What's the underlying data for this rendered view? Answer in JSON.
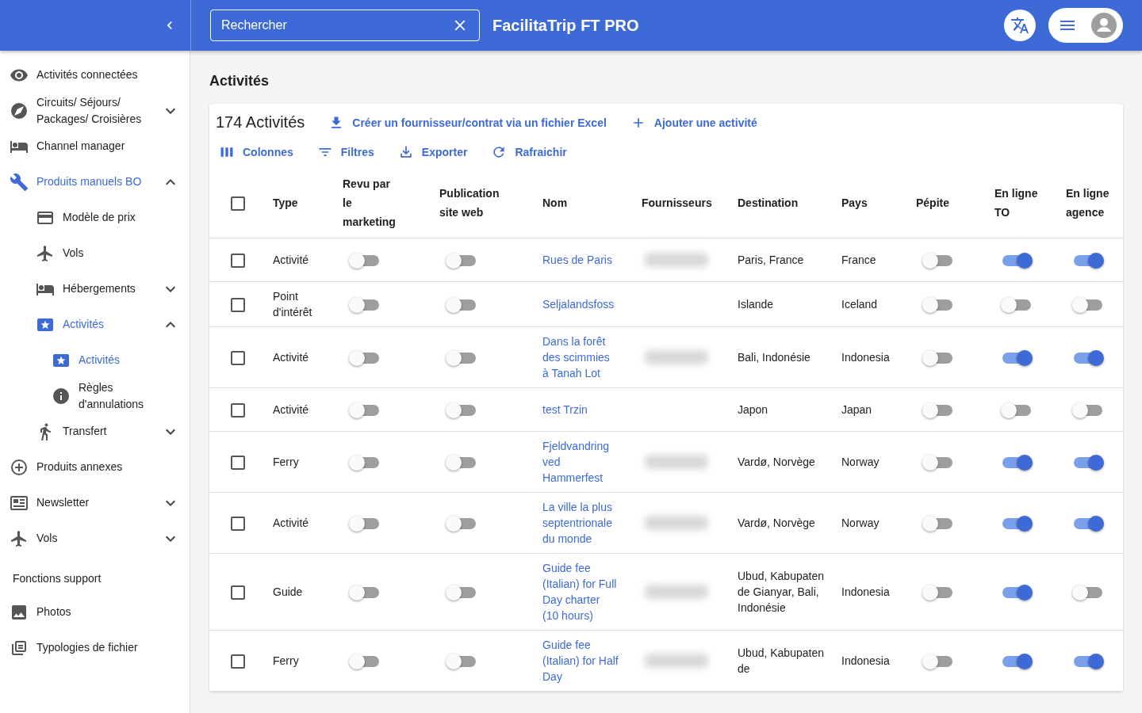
{
  "header": {
    "search": {
      "placeholder": "Rechercher"
    },
    "app_title": "FacilitaTrip FT PRO"
  },
  "sidebar": {
    "items": [
      {
        "kind": "link",
        "label": "Activités connectées",
        "selected": false
      },
      {
        "kind": "link",
        "label": "Circuits/ Séjours/ Packages/ Croisières",
        "selected": false,
        "expanded": false
      },
      {
        "kind": "link",
        "label": "Channel manager",
        "selected": false
      },
      {
        "kind": "link",
        "label": "Produits manuels BO",
        "selected": true,
        "expanded": true,
        "children": [
          {
            "label": "Modèle de prix",
            "selected": false
          },
          {
            "label": "Vols",
            "selected": false
          },
          {
            "label": "Hébergements",
            "selected": false,
            "expanded": false
          },
          {
            "label": "Activités",
            "selected": true,
            "expanded": true,
            "children": [
              {
                "label": "Activités",
                "selected": true
              },
              {
                "label": "Règles d'annulations",
                "selected": false
              }
            ]
          },
          {
            "label": "Transfert",
            "selected": false,
            "expanded": false
          }
        ]
      },
      {
        "kind": "link",
        "label": "Produits annexes",
        "selected": false
      },
      {
        "kind": "link",
        "label": "Newsletter",
        "selected": false,
        "expanded": false
      },
      {
        "kind": "link",
        "label": "Vols",
        "selected": false,
        "expanded": false
      },
      {
        "kind": "section",
        "label": "Fonctions support"
      },
      {
        "kind": "link",
        "label": "Photos",
        "selected": false
      },
      {
        "kind": "link",
        "label": "Typologies de fichier",
        "selected": false
      }
    ]
  },
  "page_title": "Activités",
  "card": {
    "count": "174 Activités",
    "actions": [
      "Créer un fournisseur/contrat via un fichier Excel",
      "Ajouter une activité"
    ],
    "toolbar": [
      "Colonnes",
      "Filtres",
      "Exporter",
      "Rafraichir"
    ]
  },
  "table": {
    "select_all_checked": false,
    "columns": [
      "Type",
      "Revu par le marketing",
      "Publication site web",
      "Nom",
      "Fournisseurs",
      "Destination",
      "Pays",
      "Pépite",
      "En ligne TO",
      "En ligne agence"
    ],
    "rows": [
      {
        "checked": false,
        "type": "Activité",
        "revu": false,
        "publication": false,
        "nom": "Rues de Paris",
        "supplier_hidden": true,
        "destination": "Paris, France",
        "pays": "France",
        "pepite": false,
        "en_ligne_to": true,
        "en_ligne_agence": true
      },
      {
        "checked": false,
        "type": "Point d'intérêt",
        "revu": false,
        "publication": false,
        "nom": "Seljalandsfoss",
        "supplier_hidden": false,
        "destination": "Islande",
        "pays": "Iceland",
        "pepite": false,
        "en_ligne_to": false,
        "en_ligne_agence": false
      },
      {
        "checked": false,
        "type": "Activité",
        "revu": false,
        "publication": false,
        "nom": "Dans la forêt des scimmies à Tanah Lot",
        "supplier_hidden": true,
        "destination": "Bali, Indonésie",
        "pays": "Indonesia",
        "pepite": false,
        "en_ligne_to": true,
        "en_ligne_agence": true
      },
      {
        "checked": false,
        "type": "Activité",
        "revu": false,
        "publication": false,
        "nom": "test Trzin",
        "supplier_hidden": false,
        "destination": "Japon",
        "pays": "Japan",
        "pepite": false,
        "en_ligne_to": false,
        "en_ligne_agence": false
      },
      {
        "checked": false,
        "type": "Ferry",
        "revu": false,
        "publication": false,
        "nom": "Fjeldvandring ved Hammerfest",
        "supplier_hidden": true,
        "destination": "Vardø, Norvège",
        "pays": "Norway",
        "pepite": false,
        "en_ligne_to": true,
        "en_ligne_agence": true
      },
      {
        "checked": false,
        "type": "Activité",
        "revu": false,
        "publication": false,
        "nom": "La ville la plus septentrionale du monde",
        "supplier_hidden": true,
        "destination": "Vardø, Norvège",
        "pays": "Norway",
        "pepite": false,
        "en_ligne_to": true,
        "en_ligne_agence": true
      },
      {
        "checked": false,
        "type": "Guide",
        "revu": false,
        "publication": false,
        "nom": "Guide fee (Italian) for Full Day charter (10 hours)",
        "supplier_hidden": true,
        "destination": "Ubud, Kabupaten de Gianyar, Bali, Indonésie",
        "pays": "Indonesia",
        "pepite": false,
        "en_ligne_to": true,
        "en_ligne_agence": false
      },
      {
        "checked": false,
        "type": "Ferry",
        "revu": false,
        "publication": false,
        "nom": "Guide fee (Italian) for Half Day",
        "supplier_hidden": true,
        "destination": "Ubud, Kabupaten de",
        "pays": "Indonesia",
        "pepite": false,
        "en_ligne_to": true,
        "en_ligne_agence": true
      }
    ]
  }
}
